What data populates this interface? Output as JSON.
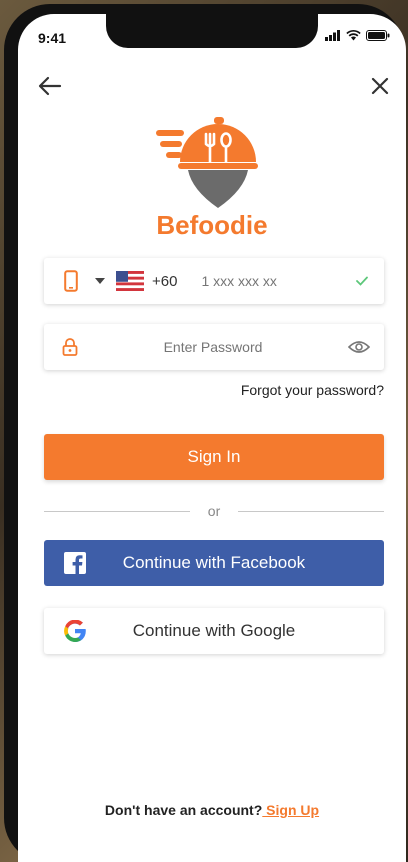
{
  "status_bar": {
    "time": "9:41",
    "icons": [
      "signal-icon",
      "wifi-icon",
      "battery-icon"
    ]
  },
  "nav": {
    "back_icon": "arrow-left-icon",
    "close_icon": "close-icon"
  },
  "brand": {
    "name": "Befoodie",
    "color": "#f47a2e"
  },
  "phone_field": {
    "country_code": "+60",
    "placeholder": "1 xxx xxx xx",
    "flag": "us-flag-icon",
    "valid_icon": "check-icon"
  },
  "password_field": {
    "placeholder": "Enter Password",
    "toggle_icon": "eye-icon"
  },
  "forgot_password": "Forgot your password?",
  "sign_in_label": "Sign In",
  "divider_label": "or",
  "facebook": {
    "label": "Continue with Facebook",
    "color": "#3e5ea8"
  },
  "google": {
    "label": "Continue with Google"
  },
  "footer": {
    "prompt": "Don't have an account?",
    "link": " Sign Up"
  },
  "colors": {
    "accent": "#f47a2e",
    "logo_gray": "#6b6b6b"
  }
}
